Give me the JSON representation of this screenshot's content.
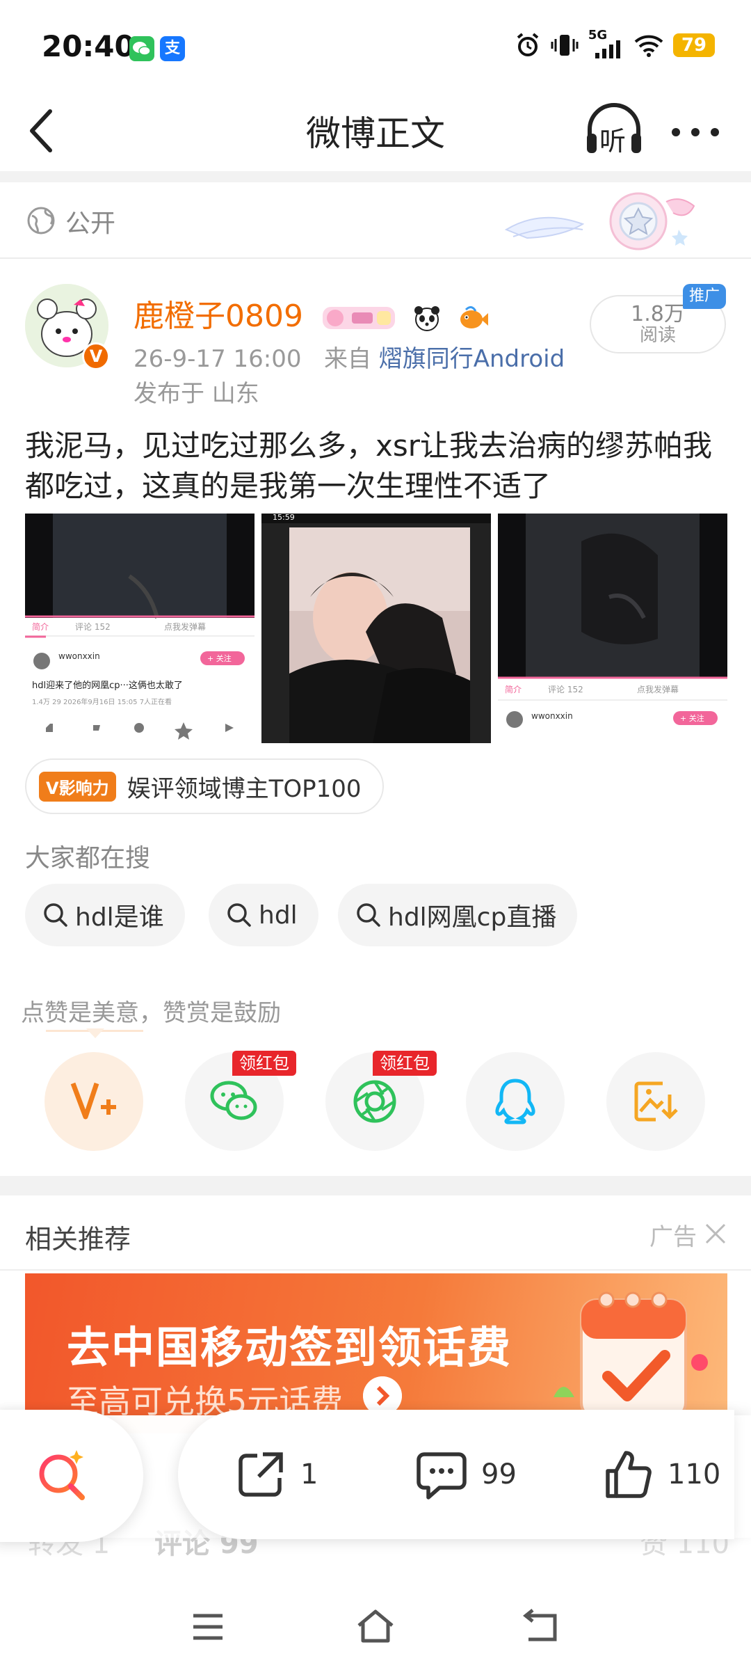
{
  "status_bar": {
    "time": "20:40",
    "app_icon_1": "wechat-icon",
    "app_icon_2": "alipay-icon",
    "alipay_glyph": "支",
    "network": "5G",
    "battery": "79"
  },
  "nav": {
    "title": "微博正文",
    "listen_label": "听"
  },
  "visibility": {
    "label": "公开"
  },
  "post": {
    "username": "鹿橙子0809",
    "time": "26-9-17 16:00",
    "source_prefix": "来自",
    "source": "熠旗同行Android",
    "location": "发布于 山东",
    "verified_glyph": "V",
    "reads": {
      "count": "1.8万",
      "label": "阅读"
    },
    "promo_tag": "推广",
    "text": "我泥马，见过吃过那么多，xsr让我去治病的缪苏帕我都吃过，这真的是我第一次生理性不适了",
    "images": [
      {
        "time": "",
        "tab1": "简介",
        "tab2": "评论 152",
        "danmu": "点我发弹幕",
        "user": "wwonxxin",
        "follow": "+ 关注",
        "title": "hdl迎来了他的网凰cp···这俩也太敢了",
        "stats": "1.4万  29  2026年9月16日 15:05  7人正在看"
      },
      {
        "time": "15:59"
      },
      {
        "tab1": "简介",
        "tab2": "评论 152",
        "danmu": "点我发弹幕",
        "user": "wwonxxin",
        "follow": "+ 关注"
      }
    ]
  },
  "influence": {
    "badge": "V影响力",
    "text": "娱评领域博主TOP100"
  },
  "trending": {
    "title": "大家都在搜",
    "chips": [
      "hdl是谁",
      "hdl",
      "hdl网凰cp直播"
    ]
  },
  "appreciate": {
    "text": "点赞是美意，赞赏是鼓励",
    "red_packet": "领红包",
    "buttons": [
      "v-plus-icon",
      "wechat-share-icon",
      "moments-share-icon",
      "qq-share-icon",
      "save-image-icon"
    ]
  },
  "recommend": {
    "title": "相关推荐",
    "ad_label": "广告",
    "ad_headline": "去中国移动签到领话费",
    "ad_sub": "至高可兑换5元话费"
  },
  "actions": {
    "repost_count": "1",
    "comment_count": "99",
    "like_count": "110"
  },
  "tabs_behind": {
    "repost": "转发 1",
    "comments": "评论 99",
    "likes": "赞 110"
  },
  "colors": {
    "accent": "#f26d00",
    "link": "#4a6ea9",
    "red_packet": "#e8262b",
    "wechat": "#2fc25b",
    "qq": "#12b7f5"
  }
}
